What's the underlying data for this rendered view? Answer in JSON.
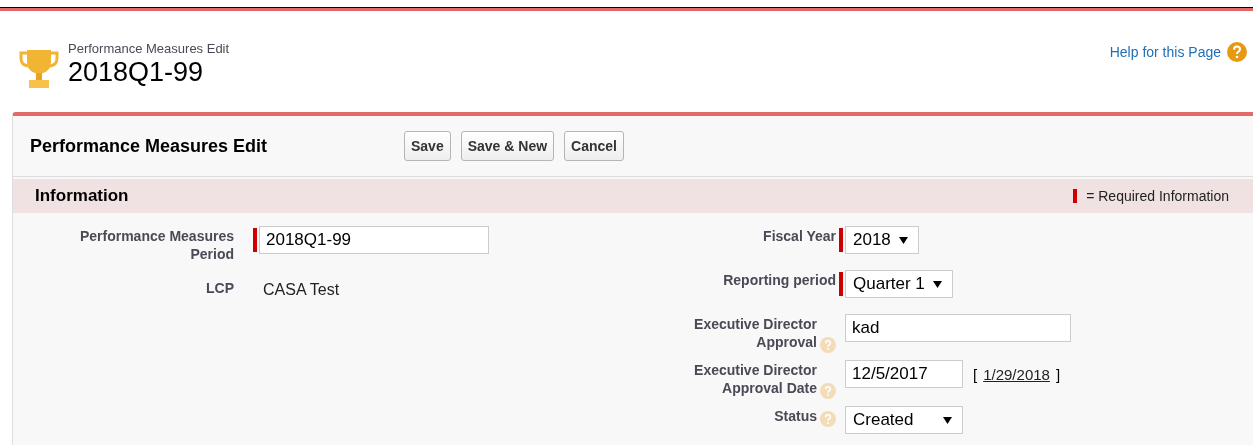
{
  "header": {
    "breadcrumb": "Performance Measures Edit",
    "title": "2018Q1-99",
    "help_link": "Help for this Page"
  },
  "panel": {
    "title": "Performance Measures Edit",
    "buttons": [
      "Save",
      "Save & New",
      "Cancel"
    ]
  },
  "section": {
    "title": "Information",
    "legend": "= Required Information"
  },
  "left_fields": [
    {
      "kind": "text",
      "label": "Performance Measures Period",
      "value": "2018Q1-99",
      "required": true,
      "help": false
    },
    {
      "kind": "static",
      "label": "LCP",
      "value": "CASA Test",
      "required": false,
      "help": false
    }
  ],
  "right_fields": [
    {
      "kind": "select",
      "label": "Fiscal Year",
      "value": "2018",
      "required": true,
      "help": false
    },
    {
      "kind": "select",
      "label": "Reporting period",
      "value": "Quarter 1",
      "required": true,
      "help": false
    },
    {
      "kind": "text",
      "label": "Executive Director Approval",
      "value": "kad",
      "required": false,
      "help": true
    },
    {
      "kind": "date",
      "label": "Executive Director Approval Date",
      "value": "12/5/2017",
      "required": false,
      "help": true,
      "today": {
        "open": "[",
        "date": "1/29/2018",
        "close": "]"
      }
    },
    {
      "kind": "select",
      "label": "Status",
      "value": "Created",
      "required": false,
      "help": true
    }
  ]
}
